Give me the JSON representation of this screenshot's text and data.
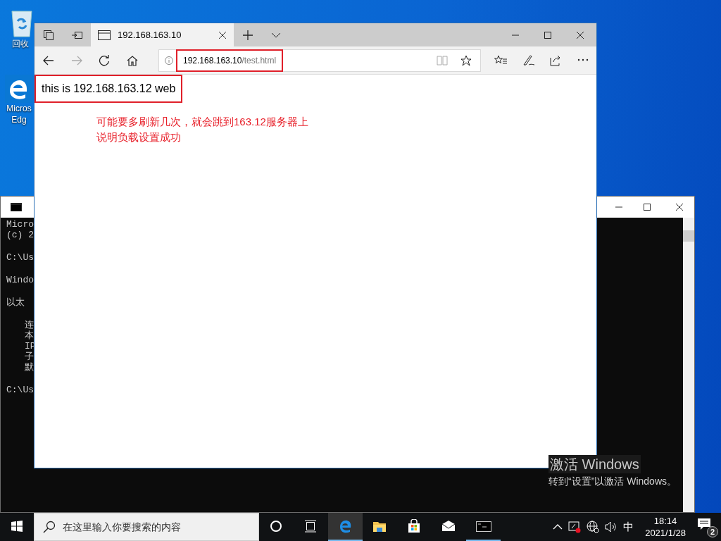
{
  "desktop_icons": [
    {
      "kind": "recycle",
      "label_lines": [
        "回收"
      ]
    },
    {
      "kind": "edge",
      "label_lines": [
        "Micros",
        "Edg"
      ]
    }
  ],
  "console": {
    "blocks": [
      {
        "indented": false,
        "lines": [
          "Micro",
          "(c) 2"
        ]
      },
      {
        "indented": false,
        "lines": [
          "C:\\Us"
        ]
      },
      {
        "indented": false,
        "lines": [
          "Windo"
        ]
      },
      {
        "indented": false,
        "lines": [
          "以太"
        ]
      },
      {
        "indented": true,
        "lines": [
          "连",
          "本",
          "IP",
          "子",
          "默"
        ]
      },
      {
        "indented": false,
        "lines": [
          "C:\\Us"
        ]
      }
    ]
  },
  "browser": {
    "tabs": [
      {
        "title": "192.168.163.10",
        "selected": true
      }
    ],
    "address": {
      "host": "192.168.163.10",
      "path": "/test.html"
    },
    "page_text": "this is 192.168.163.12 web",
    "annotation_lines": [
      "可能要多刷新几次，就会跳到163.12服务器上",
      "说明负载设置成功"
    ]
  },
  "activation_notice": {
    "title": "激活 Windows",
    "message": "转到“设置”以激活 Windows。"
  },
  "taskbar": {
    "search": {
      "placeholder": "在这里输入你要搜索的内容"
    },
    "apps": [
      {
        "kind": "cortana",
        "active": false,
        "running": false
      },
      {
        "kind": "taskview",
        "active": false,
        "running": false
      },
      {
        "kind": "edge",
        "active": true,
        "running": true
      },
      {
        "kind": "folder",
        "active": false,
        "running": false
      },
      {
        "kind": "store",
        "active": false,
        "running": false
      },
      {
        "kind": "mail",
        "active": false,
        "running": false
      },
      {
        "kind": "console",
        "active": false,
        "running": true
      }
    ],
    "input_method": "中",
    "time": "18:14",
    "date": "2021/1/28",
    "notification_count": "2"
  }
}
